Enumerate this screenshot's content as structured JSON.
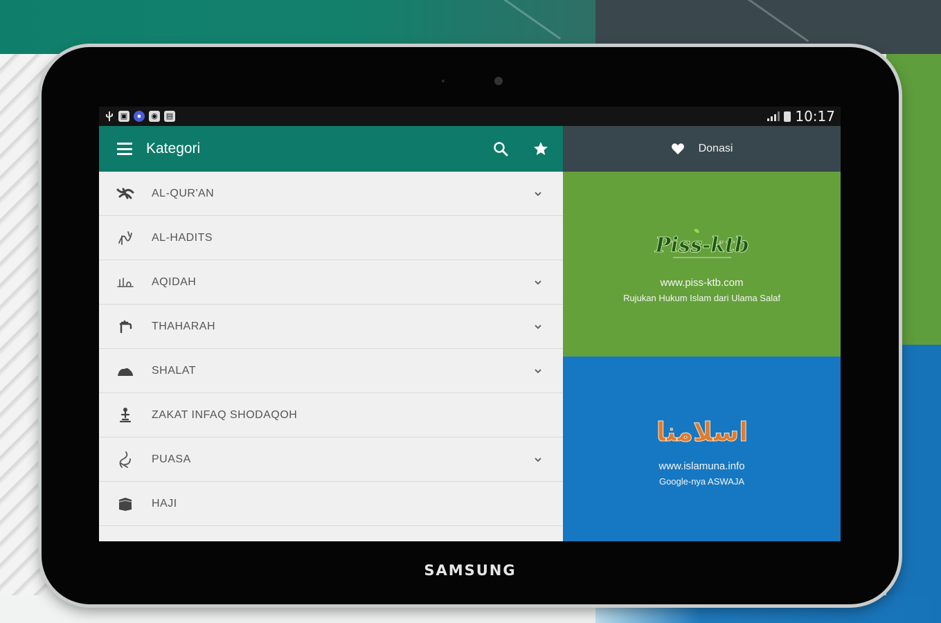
{
  "status_bar": {
    "time": "10:17"
  },
  "app_bar": {
    "title": "Kategori",
    "menu_icon": "hamburger-menu-icon",
    "search_icon": "search-icon",
    "favorite_icon": "star-icon",
    "color": "#0e7a69"
  },
  "categories": [
    {
      "label": "AL-QUR'AN",
      "icon": "quran-calligraphy-icon",
      "expandable": true
    },
    {
      "label": "AL-HADITS",
      "icon": "hadith-calligraphy-icon",
      "expandable": false
    },
    {
      "label": "AQIDAH",
      "icon": "aqidah-calligraphy-icon",
      "expandable": true
    },
    {
      "label": "THAHARAH",
      "icon": "water-tap-icon",
      "expandable": true
    },
    {
      "label": "SHALAT",
      "icon": "prayer-icon",
      "expandable": true
    },
    {
      "label": "ZAKAT INFAQ SHODAQOH",
      "icon": "charity-icon",
      "expandable": false
    },
    {
      "label": "PUASA",
      "icon": "puasa-calligraphy-icon",
      "expandable": true
    },
    {
      "label": "HAJI",
      "icon": "kaaba-icon",
      "expandable": false
    }
  ],
  "donasi": {
    "label": "Donasi",
    "icon": "heart-icon",
    "color": "#38474d"
  },
  "promos": [
    {
      "logo_text": "Piss-ktb",
      "url": "www.piss-ktb.com",
      "tagline": "Rujukan Hukum Islam dari Ulama Salaf",
      "color": "#65a13b"
    },
    {
      "logo_text": "اسلامنا",
      "url": "www.islamuna.info",
      "tagline": "Google-nya ASWAJA",
      "color": "#1678c2"
    }
  ],
  "device": {
    "brand": "SAMSUNG"
  }
}
